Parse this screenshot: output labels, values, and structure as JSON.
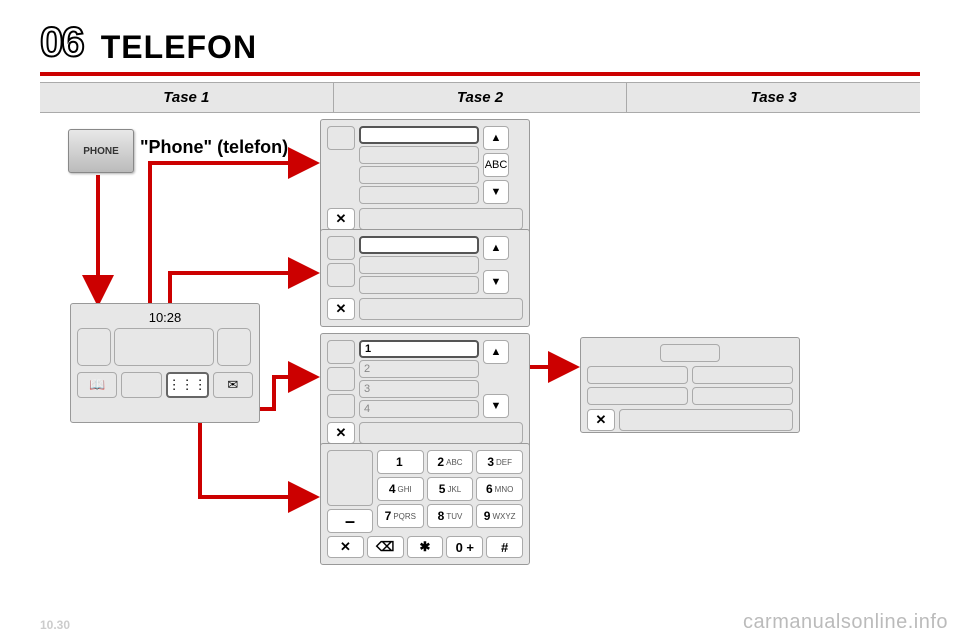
{
  "header": {
    "section_number": "06",
    "title": "TELEFON"
  },
  "levels": [
    "Tase 1",
    "Tase 2",
    "Tase 3"
  ],
  "phone_button": {
    "label": "PHONE"
  },
  "phone_caption": "\"Phone\" (telefon)",
  "device": {
    "time": "10:28",
    "icons": {
      "book": "📖",
      "grid": "⋮⋮⋮",
      "mail": "✉"
    }
  },
  "panel_abc": {
    "sort_label": "ABC",
    "up": "▲",
    "down": "▼",
    "close": "✕"
  },
  "panel_plain": {
    "up": "▲",
    "down": "▼",
    "close": "✕"
  },
  "panel_numbers": {
    "items": [
      "1",
      "2",
      "3",
      "4"
    ],
    "up": "▲",
    "down": "▼",
    "close": "✕"
  },
  "keypad": {
    "keys": [
      {
        "n": "1",
        "l": ""
      },
      {
        "n": "2",
        "l": "ABC"
      },
      {
        "n": "3",
        "l": "DEF"
      },
      {
        "n": "4",
        "l": "GHI"
      },
      {
        "n": "5",
        "l": "JKL"
      },
      {
        "n": "6",
        "l": "MNO"
      },
      {
        "n": "7",
        "l": "PQRS"
      },
      {
        "n": "8",
        "l": "TUV"
      },
      {
        "n": "9",
        "l": "WXYZ"
      }
    ],
    "dash": "–",
    "bottom": [
      "✕",
      "⌫",
      "✱",
      "0 +",
      "#"
    ]
  },
  "detail_panel": {
    "close": "✕"
  },
  "watermark": "carmanualsonline.info",
  "page_number": "10.30",
  "chart_data": {
    "type": "diagram",
    "title": "TELEFON menu navigation",
    "columns": [
      "Tase 1",
      "Tase 2",
      "Tase 3"
    ],
    "nodes": [
      {
        "id": "btn",
        "col": 0,
        "label": "PHONE hardware button"
      },
      {
        "id": "home",
        "col": 0,
        "label": "Phone home screen (10:28, book/grid/mail icons)"
      },
      {
        "id": "abc",
        "col": 1,
        "label": "Contacts list (ABC sort)"
      },
      {
        "id": "list",
        "col": 1,
        "label": "Generic list"
      },
      {
        "id": "numbered",
        "col": 1,
        "label": "Numbered list 1–4"
      },
      {
        "id": "keypad",
        "col": 1,
        "label": "Dial keypad 0–9 * #"
      },
      {
        "id": "detail",
        "col": 2,
        "label": "Contact detail"
      }
    ],
    "edges": [
      {
        "from": "btn",
        "to": "home"
      },
      {
        "from": "home",
        "to": "abc",
        "via": "book icon"
      },
      {
        "from": "home",
        "to": "list"
      },
      {
        "from": "home",
        "to": "numbered",
        "via": "mail icon"
      },
      {
        "from": "home",
        "to": "keypad",
        "via": "grid icon"
      },
      {
        "from": "numbered",
        "to": "detail",
        "via": "item 1"
      }
    ]
  }
}
